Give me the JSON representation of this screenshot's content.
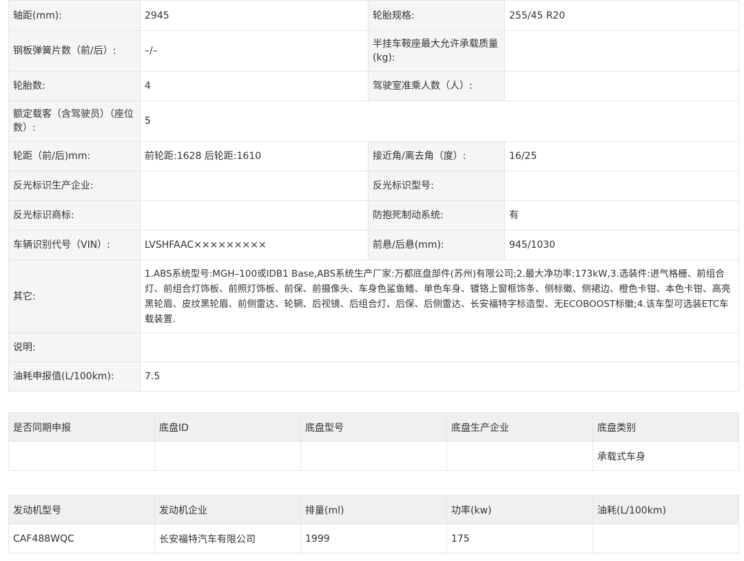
{
  "vehicle_params": {
    "wheelbase_label": "轴距(mm):",
    "wheelbase_value": "2945",
    "tire_spec_label": "轮胎规格:",
    "tire_spec_value": "255/45 R20",
    "leaf_spring_label": "钢板弹簧片数（前/后）:",
    "leaf_spring_value": "–/–",
    "saddle_load_label": "半挂车鞍座最大允许承载质量(kg):",
    "saddle_load_value": "",
    "tire_count_label": "轮胎数:",
    "tire_count_value": "4",
    "cab_seats_label": "驾驶室准乘人数（人）:",
    "cab_seats_value": "",
    "rated_passengers_label": "额定载客（含驾驶员）（座位数）:",
    "rated_passengers_value": "5",
    "track_label": "轮距（前/后)mm:",
    "track_value": "前轮距:1628 后轮距:1610",
    "approach_angle_label": "接近角/离去角（度）:",
    "approach_angle_value": "16/25",
    "reflector_maker_label": "反光标识生产企业:",
    "reflector_maker_value": "",
    "reflector_model_label": "反光标识型号:",
    "reflector_model_value": "",
    "reflector_brand_label": "反光标识商标:",
    "reflector_brand_value": "",
    "abs_label": "防抱死制动系统:",
    "abs_value": "有",
    "vin_label": "车辆识别代号（VIN）:",
    "vin_value": "LVSHFAAC×××××××××",
    "overhang_label": "前悬/后悬(mm):",
    "overhang_value": "945/1030",
    "other_label": "其它:",
    "other_value": "1.ABS系统型号:MGH–100或IDB1 Base,ABS系统生产厂家:万都底盘部件(苏州)有限公司;2.最大净功率:173kW,3.选装件:进气格栅、前组合灯、前组合灯饰板、前照灯饰板、前保、前摄像头、车身色鲨鱼鳍、单色车身、镀铬上窗框饰条、侧标徽、侧裙边、橙色卡钳、本色卡钳、高亮黑轮眉、皮纹黑轮眉、前侧雷达、轮辋、后视镜、后组合灯、后保、后侧雷达、长安福特字标造型、无ECOBOOST标徽;4.该车型可选装ETC车载装置.",
    "note_label": "说明:",
    "note_value": "",
    "fuel_label": "油耗申报值(L/100km):",
    "fuel_value": "7.5"
  },
  "chassis_table": {
    "headers": [
      "是否同期申报",
      "底盘ID",
      "底盘型号",
      "底盘生产企业",
      "底盘类别"
    ],
    "rows": [
      [
        "",
        "",
        "",
        "",
        "承载式车身"
      ]
    ]
  },
  "engine_table": {
    "headers": [
      "发动机型号",
      "发动机企业",
      "排量(ml)",
      "功率(kw)",
      "油耗(L/100km)"
    ],
    "rows": [
      [
        "CAF488WQC",
        "长安福特汽车有限公司",
        "1999",
        "175",
        ""
      ]
    ]
  }
}
